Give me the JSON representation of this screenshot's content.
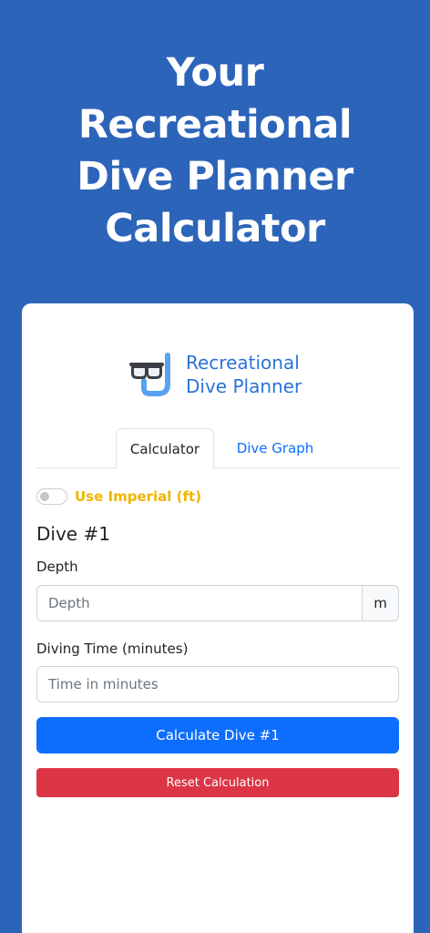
{
  "hero": {
    "line1": "Your",
    "line2": "Recreational",
    "line3": "Dive Planner",
    "line4": "Calculator"
  },
  "logo": {
    "line1": "Recreational",
    "line2": "Dive Planner",
    "icon": "snorkel-mask-icon"
  },
  "tabs": [
    {
      "label": "Calculator",
      "active": true
    },
    {
      "label": "Dive Graph",
      "active": false
    }
  ],
  "units_toggle": {
    "label": "Use Imperial (ft)",
    "on": false
  },
  "dive": {
    "title": "Dive #1"
  },
  "depth": {
    "label": "Depth",
    "placeholder": "Depth",
    "unit": "m"
  },
  "time": {
    "label": "Diving Time (minutes)",
    "placeholder": "Time in minutes"
  },
  "buttons": {
    "calculate": "Calculate Dive #1",
    "reset": "Reset Calculation"
  },
  "colors": {
    "background": "#2c64b9",
    "primary": "#0d6efd",
    "danger": "#dc3545",
    "toggle_label": "#f0b400",
    "logo_text": "#2b73d9"
  }
}
